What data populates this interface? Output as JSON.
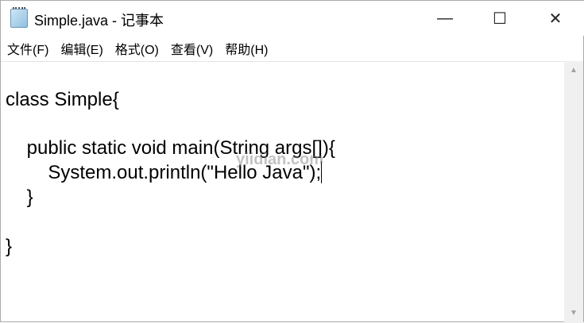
{
  "window": {
    "title": "Simple.java - 记事本",
    "minimize": "—",
    "maximize": "☐",
    "close": "✕"
  },
  "menu": [
    "文件(F)",
    "编辑(E)",
    "格式(O)",
    "查看(V)",
    "帮助(H)"
  ],
  "editor": {
    "lines": [
      "",
      "class Simple{",
      "",
      "    public static void main(String args[]){",
      "        System.out.println(\"Hello Java\");",
      "    }",
      "",
      "}"
    ],
    "watermark": "yiidian.com"
  },
  "scrollbar": {
    "up": "▲",
    "down": "▼"
  }
}
